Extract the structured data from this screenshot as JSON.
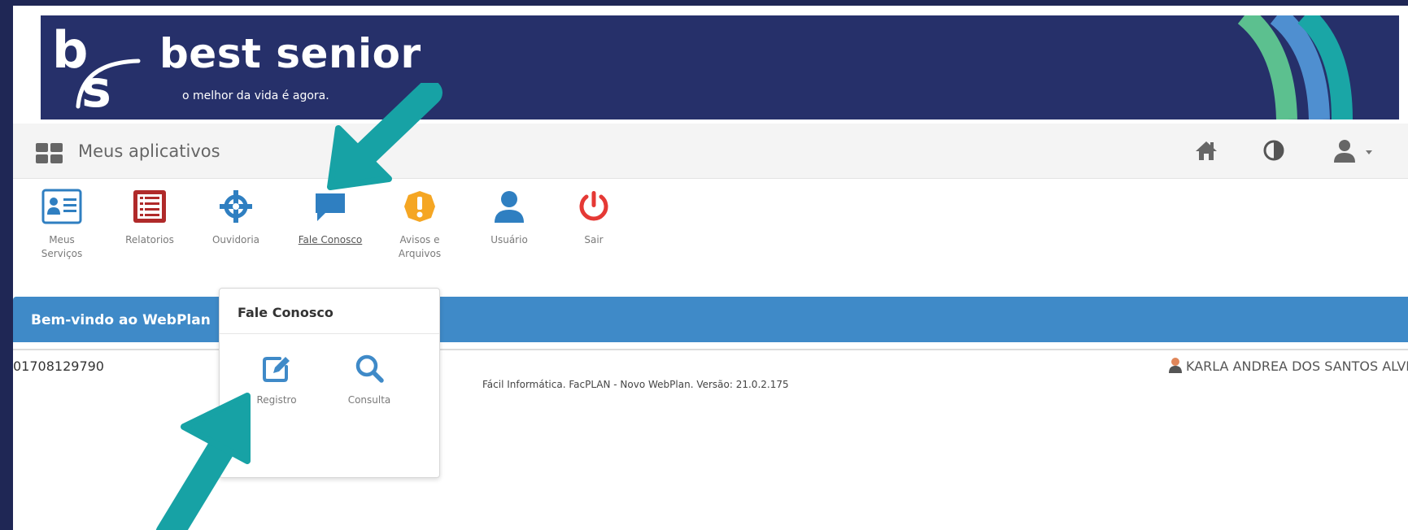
{
  "brand": {
    "name": "best senior",
    "tagline": "o melhor da vida é agora.",
    "logo_letter_top": "b",
    "logo_letter_bottom": "s"
  },
  "navbar": {
    "apps_label": "Meus aplicativos",
    "icons": [
      "home-icon",
      "contrast-icon",
      "user-icon",
      "caret-down-icon"
    ]
  },
  "apps": [
    {
      "label_line1": "Meus",
      "label_line2": "Serviços",
      "icon": "id-card-icon",
      "color": "#2f7fc1"
    },
    {
      "label_line1": "Relatorios",
      "label_line2": "",
      "icon": "list-report-icon",
      "color": "#b02a2a"
    },
    {
      "label_line1": "Ouvidoria",
      "label_line2": "",
      "icon": "crosshair-icon",
      "color": "#2f7fc1"
    },
    {
      "label_line1": "Fale Conosco",
      "label_line2": "",
      "icon": "chat-bubble-icon",
      "color": "#2f7fc1"
    },
    {
      "label_line1": "Avisos e",
      "label_line2": "Arquivos",
      "icon": "warning-badge-icon",
      "color": "#f5a623"
    },
    {
      "label_line1": "Usuário",
      "label_line2": "",
      "icon": "user-icon",
      "color": "#2f7fc1"
    },
    {
      "label_line1": "Sair",
      "label_line2": "",
      "icon": "power-icon",
      "color": "#e53935"
    }
  ],
  "welcome": {
    "text": "Bem-vindo ao WebPlan"
  },
  "footer": {
    "user_code": "01708129790",
    "version": "Fácil Informática. FacPLAN - Novo WebPlan. Versão: 21.0.2.175",
    "user_name": "KARLA ANDREA DOS SANTOS ALVES"
  },
  "dropdown": {
    "title": "Fale Conosco",
    "items": [
      {
        "label": "Registro",
        "icon": "edit-icon"
      },
      {
        "label": "Consulta",
        "icon": "search-icon"
      }
    ]
  },
  "colors": {
    "frame": "#1f2755",
    "banner": "#26306a",
    "welcome_bar": "#3f8ac8",
    "arrow": "#17a2a5"
  }
}
